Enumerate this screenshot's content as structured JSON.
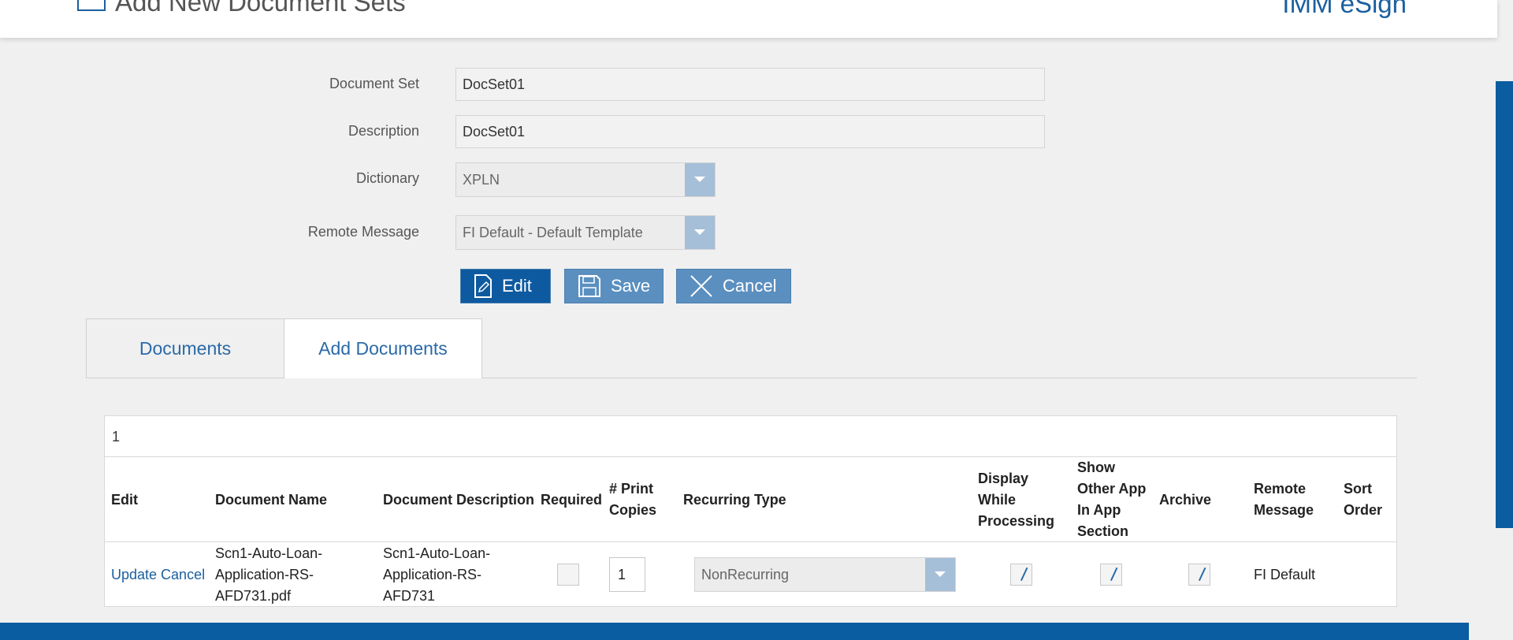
{
  "header": {
    "page_title": "Add New Document Sets",
    "brand": "IMM eSign"
  },
  "form": {
    "document_set": {
      "label": "Document Set",
      "value": "DocSet01"
    },
    "description": {
      "label": "Description",
      "value": "DocSet01"
    },
    "dictionary": {
      "label": "Dictionary",
      "value": "XPLN"
    },
    "remote_message": {
      "label": "Remote Message",
      "value": "FI Default - Default Template"
    }
  },
  "actions": {
    "edit": "Edit",
    "save": "Save",
    "cancel": "Cancel"
  },
  "tabs": [
    {
      "label": "Documents",
      "active": false
    },
    {
      "label": "Add Documents",
      "active": true
    }
  ],
  "grid": {
    "page_number": "1",
    "columns": [
      "Edit",
      "Document Name",
      "Document Description",
      "Required",
      "# Print Copies",
      "Recurring Type",
      "Display While Processing",
      "Show Other App In App Section",
      "Archive",
      "Remote Message",
      "Sort Order"
    ],
    "row": {
      "update_link": "Update",
      "cancel_link": "Cancel",
      "document_name": "Scn1-Auto-Loan-Application-RS-AFD731.pdf",
      "document_description": "Scn1-Auto-Loan-Application-RS-AFD731",
      "required": false,
      "print_copies": "1",
      "recurring_type": "NonRecurring",
      "display_while_processing": true,
      "show_other_app": true,
      "archive": true,
      "remote_message": "FI Default",
      "sort_order": ""
    }
  },
  "colors": {
    "primary": "#0e5aa0",
    "secondary_button": "#5b8fc0",
    "link": "#1a5fa0"
  }
}
